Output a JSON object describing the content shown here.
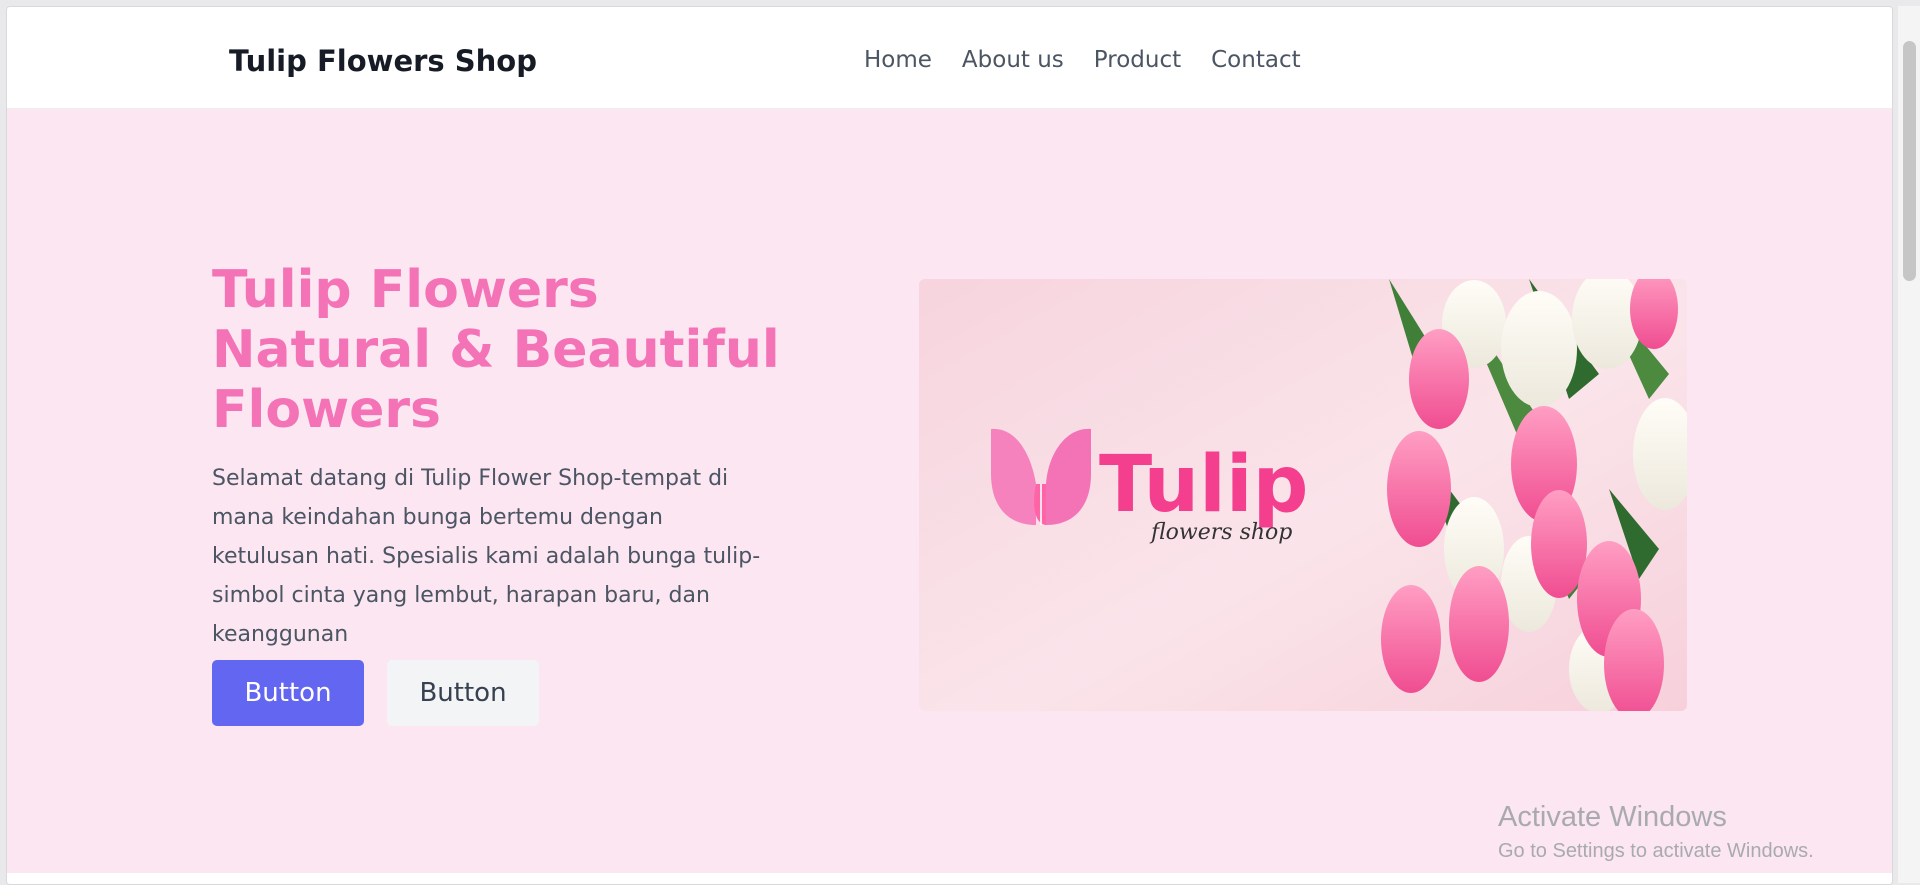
{
  "header": {
    "brand": "Tulip Flowers Shop",
    "nav": [
      "Home",
      "About us",
      "Product",
      "Contact"
    ]
  },
  "hero": {
    "title_lines": [
      "Tulip Flowers",
      "Natural & Beautiful",
      "Flowers"
    ],
    "description": "Selamat datang di Tulip Flower Shop-tempat di mana keindahan bunga bertemu dengan ketulusan hati. Spesialis kami adalah bunga tulip-simbol cinta yang lembut, harapan baru, dan keanggunan",
    "primary_button": "Button",
    "secondary_button": "Button",
    "image_logo": "Tulip",
    "image_logo_sub": "flowers shop"
  },
  "watermark": {
    "title": "Activate Windows",
    "subtitle": "Go to Settings to activate Windows."
  },
  "colors": {
    "accent": "#f472b6",
    "hero_bg": "#fce6f1",
    "primary_button": "#6366f1"
  }
}
